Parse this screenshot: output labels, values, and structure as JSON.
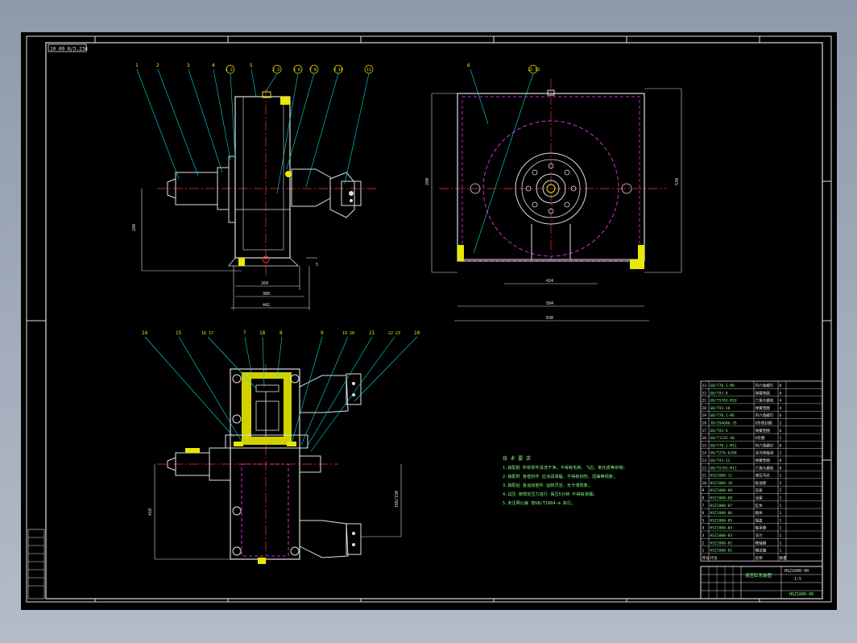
{
  "sheet": {
    "corner_code": "10 00 0/3.234"
  },
  "views": {
    "front_balloons": [
      "1",
      "2",
      "3",
      "4",
      "1 2",
      "5",
      "2 3",
      "5 6",
      "7 8",
      "9 10",
      "11"
    ],
    "side_balloons": [
      "6",
      "12 13"
    ],
    "section_balloons": [
      "14",
      "15",
      "16 17",
      "7",
      "18",
      "8",
      "9",
      "19 20",
      "21",
      "22 23",
      "10"
    ],
    "dims": {
      "front_width_a": "264",
      "front_width_b": "380",
      "front_width_c": "442",
      "front_height": "280",
      "front_small": "5",
      "side_height_left": "280",
      "side_height_right": "530",
      "side_width_inner": "424",
      "side_width_mid": "584",
      "side_width_outer": "630",
      "section_height_left": "410",
      "section_height_right": "160/150"
    }
  },
  "notes": {
    "title": "技 术 要 求",
    "lines": [
      "1.装配前 所有零件清洗干净，不得有毛刺、飞边、氧化皮等杂物；",
      "2.装配时 各密封件 应涂润滑脂，不得有划伤、扭曲等现象；",
      "3.装配后 各运动部件 运转灵活，无卡滞现象；",
      "4.试压 按规定压力进行 保压5分钟 不得有渗漏；",
      "5.未注明公差 按GB/T1804-m 执行。"
    ]
  },
  "bom": {
    "rows": [
      [
        "23",
        "GB/T70.1-M8",
        "内六角螺钉",
        "8"
      ],
      [
        "22",
        "GB/T93-8",
        "弹簧垫圈",
        "8"
      ],
      [
        "21",
        "GB/T5783-M10",
        "六角头螺栓",
        "4"
      ],
      [
        "20",
        "GB/T93-10",
        "弹簧垫圈",
        "4"
      ],
      [
        "19",
        "GB/T70.1-M6",
        "内六角螺钉",
        "6"
      ],
      [
        "18",
        "JB/ZQ4606-35",
        "O形密封圈",
        "2"
      ],
      [
        "17",
        "GB/T93-6",
        "弹簧垫圈",
        "6"
      ],
      [
        "16",
        "GB/T1235-40",
        "O形圈",
        "1"
      ],
      [
        "15",
        "GB/T70.1-M12",
        "内六角螺钉",
        "8"
      ],
      [
        "14",
        "GB/T276-6208",
        "深沟球轴承",
        "2"
      ],
      [
        "13",
        "GB/T93-12",
        "弹簧垫圈",
        "8"
      ],
      [
        "12",
        "GB/T5783-M12",
        "六角头螺栓",
        "8"
      ],
      [
        "11",
        "HSZ1000-11",
        "液压马达",
        "1"
      ],
      [
        "10",
        "HSZ1000-10",
        "吸油管",
        "2"
      ],
      [
        "9",
        "HSZ1000-09",
        "压板",
        "2"
      ],
      [
        "8",
        "HSZ1000-08",
        "活塞",
        "1"
      ],
      [
        "7",
        "HSZ1000-07",
        "缸体",
        "1"
      ],
      [
        "6",
        "HSZ1000-06",
        "箱体",
        "1"
      ],
      [
        "5",
        "HSZ1000-05",
        "端盖",
        "1"
      ],
      [
        "4",
        "HSZ1000-04",
        "轴承座",
        "1"
      ],
      [
        "3",
        "HSZ1000-03",
        "法兰",
        "1"
      ],
      [
        "2",
        "HSZ1000-02",
        "联轴器",
        "1"
      ],
      [
        "1",
        "HSZ1000-01",
        "输出轴",
        "1"
      ]
    ],
    "header": [
      "序号",
      "代号",
      "名称",
      "数量"
    ]
  },
  "title_block": {
    "drawing_name": "液压缸总装图",
    "drawing_no": "HSZ1000-00",
    "scale": "1:5",
    "company": "HSZ1000-00"
  },
  "rev_box": [
    "设计",
    "审核",
    "工艺",
    "标准化",
    "批准",
    "日期"
  ]
}
